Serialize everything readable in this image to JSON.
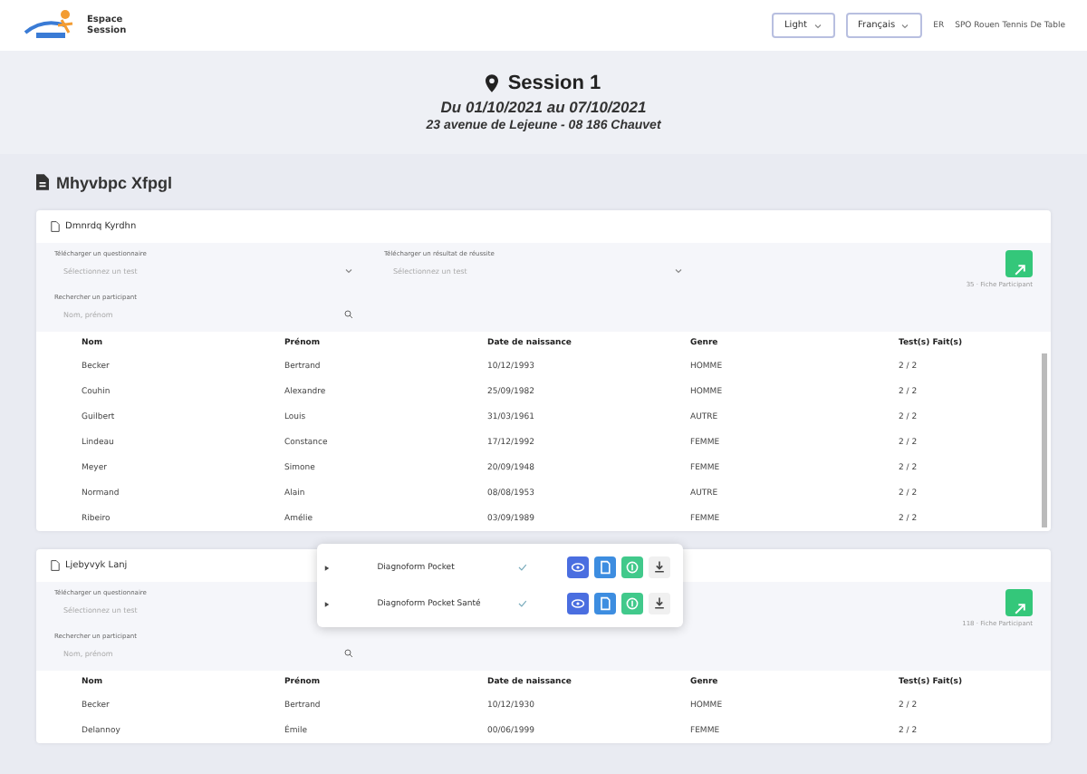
{
  "header": {
    "app_name": "Espace\nSession",
    "theme": "Light",
    "language": "Français",
    "user_initials": "ER",
    "organization": "SPO Rouen Tennis De Table"
  },
  "session": {
    "title": "Session 1",
    "dates": "Du 01/10/2021 au 07/10/2021",
    "address": "23 avenue de Lejeune - 08 186 Chauvet"
  },
  "section_title": "Mhyvbpc Xfpgl",
  "groups": [
    {
      "title": "Dmnrdq Kyrdhn",
      "filter_1": {
        "label": "Télécharger un questionnaire",
        "placeholder": "Sélectionnez un test"
      },
      "filter_2": {
        "label": "Télécharger un résultat de réussite",
        "placeholder": "Sélectionnez un test"
      },
      "search": {
        "label": "Rechercher un participant",
        "placeholder": "Nom, prénom"
      },
      "count": "35 · Fiche Participant",
      "columns": [
        "Nom",
        "Prénom",
        "Date de naissance",
        "Genre",
        "Test(s) Fait(s)"
      ],
      "rows": [
        [
          "Becker",
          "Bertrand",
          "10/12/1993",
          "HOMME",
          "2 / 2"
        ],
        [
          "Couhin",
          "Alexandre",
          "25/09/1982",
          "HOMME",
          "2 / 2"
        ],
        [
          "Guilbert",
          "Louis",
          "31/03/1961",
          "AUTRE",
          "2 / 2"
        ],
        [
          "Lindeau",
          "Constance",
          "17/12/1992",
          "FEMME",
          "2 / 2"
        ],
        [
          "Meyer",
          "Simone",
          "20/09/1948",
          "FEMME",
          "2 / 2"
        ],
        [
          "Normand",
          "Alain",
          "08/08/1953",
          "AUTRE",
          "2 / 2"
        ],
        [
          "Ribeiro",
          "Amélie",
          "03/09/1989",
          "FEMME",
          "2 / 2"
        ]
      ]
    },
    {
      "title": "Ljebyvyk Lanj",
      "filter_1": {
        "label": "Télécharger un questionnaire",
        "placeholder": "Sélectionnez un test"
      },
      "search": {
        "label": "Rechercher un participant",
        "placeholder": "Nom, prénom"
      },
      "count": "118 · Fiche Participant",
      "columns": [
        "Nom",
        "Prénom",
        "Date de naissance",
        "Genre",
        "Test(s) Fait(s)"
      ],
      "rows": [
        [
          "Becker",
          "Bertrand",
          "10/12/1930",
          "HOMME",
          "2 / 2"
        ],
        [
          "Delannoy",
          "Émile",
          "00/06/1999",
          "FEMME",
          "2 / 2"
        ]
      ]
    }
  ],
  "popup": {
    "items": [
      {
        "name": "Diagnoform Pocket",
        "done": true
      },
      {
        "name": "Diagnoform Pocket Santé",
        "done": true
      }
    ]
  }
}
